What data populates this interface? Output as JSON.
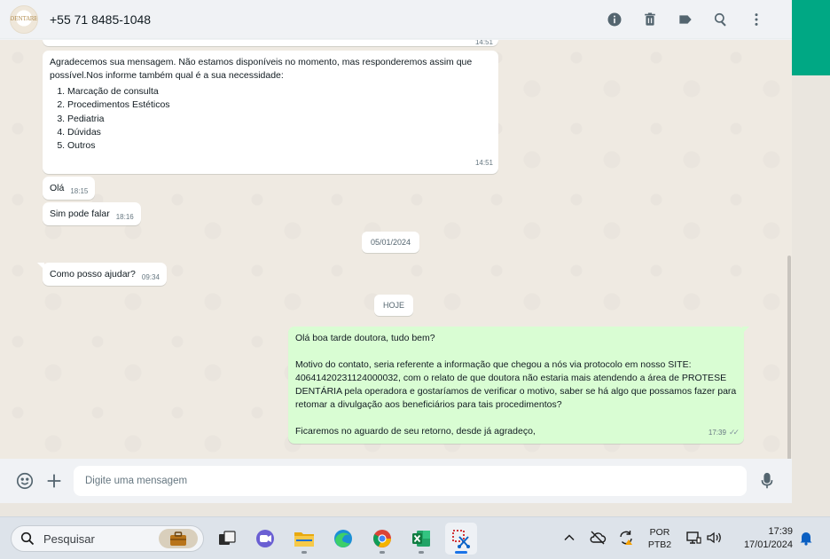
{
  "header": {
    "avatar_text": "DENTARE",
    "contact_name": "+55 71 8485-1048",
    "actions": [
      "info-icon",
      "delete-icon",
      "label-icon",
      "search-icon",
      "menu-icon"
    ]
  },
  "messages": {
    "top_time": "14:51",
    "m1": {
      "text": "Agradecemos sua mensagem. Não estamos disponíveis no momento, mas responderemos assim que possível.Nos informe também qual é a sua necessidade:",
      "options": [
        "Marcação de consulta",
        "Procedimentos Estéticos",
        "Pediatria",
        "Dúvidas",
        "Outros"
      ],
      "time": "14:51"
    },
    "m2": {
      "text": "Olá",
      "time": "18:15"
    },
    "m3": {
      "text": "Sim pode falar",
      "time": "18:16"
    },
    "date1": "05/01/2024",
    "m4": {
      "text": "Como posso ajudar?",
      "time": "09:34"
    },
    "date2": "HOJE",
    "m5": {
      "line1": "Olá boa tarde doutora, tudo bem?",
      "line2": "Motivo do contato, seria referente a informação que chegou a nós via protocolo em nosso SITE: 40641420231124000032, com o relato de que doutora não estaria mais atendendo a área de PROTESE DENTÁRIA pela operadora e gostaríamos de verificar o motivo, saber se há algo que possamos fazer para retomar a divulgação aos beneficiários para tais procedimentos?",
      "line3": "Ficaremos no aguardo de seu retorno, desde já agradeço,",
      "time": "17:39"
    }
  },
  "composer": {
    "placeholder": "Digite uma mensagem"
  },
  "taskbar": {
    "search_label": "Pesquisar",
    "lang_top": "POR",
    "lang_bottom": "PTB2",
    "time": "17:39",
    "date": "17/01/2024"
  },
  "colors": {
    "accent": "#00a884",
    "outgoing": "#d9fdd3",
    "chat_bg": "#efeae2"
  }
}
